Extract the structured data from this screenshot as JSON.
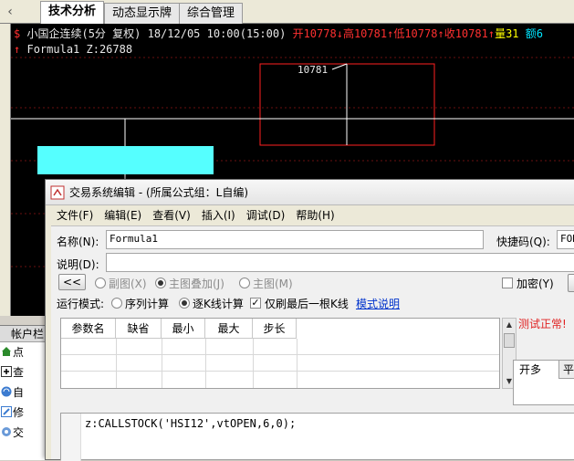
{
  "tabs": [
    {
      "label": "技术分析",
      "active": true
    },
    {
      "label": "动态显示牌",
      "active": false
    },
    {
      "label": "综合管理",
      "active": false
    }
  ],
  "chart": {
    "symbol": "小国企连续(5分 复权)",
    "datetime": "18/12/05 10:00(15:00)",
    "open_label": "开",
    "open": "10778",
    "high_label": "高",
    "high": "10781",
    "low_label": "低",
    "low": "10778",
    "close_label": "收",
    "close": "10781",
    "volume_label": "量",
    "volume": "31",
    "amount_label": "额",
    "amount": "6",
    "formula": "Formula1",
    "formula_value": "Z:26788",
    "price_tag": "10781"
  },
  "account_panel": {
    "header": "帐户栏",
    "items": [
      "点",
      "查",
      "自",
      "修",
      "交"
    ]
  },
  "dialog": {
    "title": "交易系统编辑 - (所属公式组：L自编)",
    "menu": [
      "文件(F)",
      "编辑(E)",
      "查看(V)",
      "插入(I)",
      "调试(D)",
      "帮助(H)"
    ],
    "name_label": "名称(N):",
    "name_value": "Formula1",
    "shortcut_label": "快捷码(Q):",
    "shortcut_value": "FOR",
    "desc_label": "说明(D):",
    "back_button": "<<",
    "chart_options": [
      "副图(X)",
      "主图叠加(J)",
      "主图(M)"
    ],
    "encrypt_label": "加密(Y)",
    "mode_label": "运行模式:",
    "mode_options": [
      "序列计算",
      "逐K线计算"
    ],
    "last_bar_label": "仅刷最后一根K线",
    "mode_link": "模式说明",
    "param_columns": [
      "参数名",
      "缺省",
      "最小",
      "最大",
      "步长"
    ],
    "test_status": "测试正常!",
    "side_tabs": [
      "开多",
      "平"
    ],
    "code": "z:CALLSTOCK('HSI12',vtOPEN,6,0);"
  }
}
